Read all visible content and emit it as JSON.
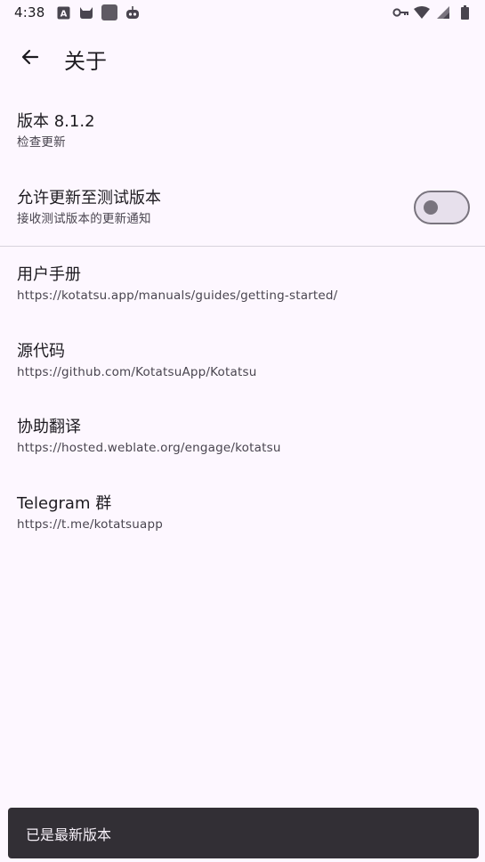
{
  "status_bar": {
    "time": "4:38",
    "left_icons": [
      "translate-icon",
      "cat-icon",
      "app-square-icon",
      "robot-icon"
    ],
    "right_icons": [
      "vpn-key-icon",
      "wifi-icon",
      "signal-icon",
      "battery-icon"
    ]
  },
  "app_bar": {
    "title": "关于",
    "back_icon": "arrow-back-icon"
  },
  "preferences": {
    "version": {
      "title": "版本 8.1.2",
      "summary": "检查更新"
    },
    "beta_updates": {
      "title": "允许更新至测试版本",
      "summary": "接收测试版本的更新通知",
      "enabled": false
    },
    "user_manual": {
      "title": "用户手册",
      "summary": "https://kotatsu.app/manuals/guides/getting-started/"
    },
    "source_code": {
      "title": "源代码",
      "summary": "https://github.com/KotatsuApp/Kotatsu"
    },
    "translate": {
      "title": "协助翻译",
      "summary": "https://hosted.weblate.org/engage/kotatsu"
    },
    "telegram": {
      "title": "Telegram 群",
      "summary": "https://t.me/kotatsuapp"
    }
  },
  "snackbar": {
    "message": "已是最新版本"
  },
  "colors": {
    "background": "#fdf7ff",
    "snackbar": "#322f35",
    "switch_off": "#79747e"
  }
}
